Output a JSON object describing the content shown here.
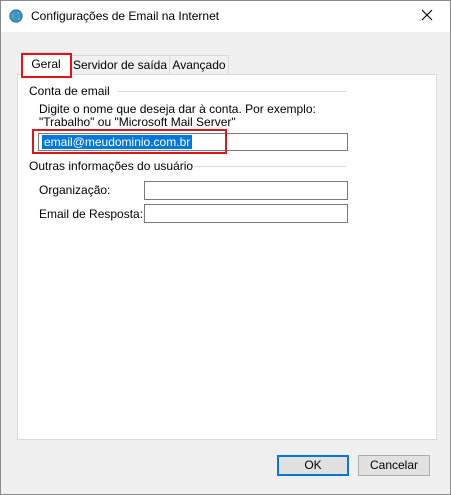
{
  "window": {
    "title": "Configurações de Email na Internet",
    "close_icon": "close-icon",
    "title_icon": "globe-mail-icon"
  },
  "tabs": [
    {
      "label": "Geral",
      "active": true
    },
    {
      "label": "Servidor de saída",
      "active": false
    },
    {
      "label": "Avançado",
      "active": false
    }
  ],
  "account_group": {
    "label": "Conta de email",
    "description_line1": "Digite o nome que deseja dar à conta. Por exemplo:",
    "description_line2": "\"Trabalho\" ou \"Microsoft Mail Server\"",
    "account_name_value": "email@meudominio.com.br"
  },
  "user_info_group": {
    "label": "Outras informações do usuário",
    "organization_label": "Organização:",
    "organization_value": "",
    "reply_email_label": "Email de Resposta:",
    "reply_email_value": ""
  },
  "buttons": {
    "ok": "OK",
    "cancel": "Cancelar"
  },
  "colors": {
    "highlight_red": "#e0151c",
    "selection_blue": "#0078d7"
  }
}
